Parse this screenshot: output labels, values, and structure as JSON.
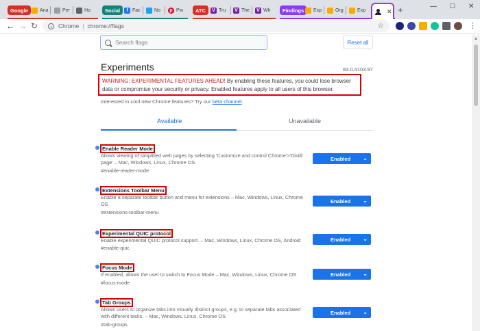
{
  "browser": {
    "tab_groups": [
      {
        "label": "Google",
        "color": "#d93025"
      },
      {
        "label": "Social",
        "color": "#12857a"
      },
      {
        "label": "ATC",
        "color": "#d93025"
      },
      {
        "label": "Findings",
        "color": "#8b3cf0"
      }
    ],
    "tabs": [
      {
        "label": "Ana",
        "icon": "analytics-icon",
        "color": "#f9ab00"
      },
      {
        "label": "Per",
        "icon": "bulb-icon",
        "color": "#5f6368"
      },
      {
        "label": "Ho",
        "icon": "hootsuite-icon",
        "color": "#5f6368"
      },
      {
        "label": "Fac",
        "icon": "facebook-icon",
        "color": "#1877f2"
      },
      {
        "label": "No",
        "icon": "twitter-icon",
        "color": "#1da1f2"
      },
      {
        "label": "Pin",
        "icon": "pinterest-icon",
        "color": "#e60023"
      },
      {
        "label": "Tru",
        "icon": "v-icon",
        "color": "#7b1fa2"
      },
      {
        "label": "The",
        "icon": "v-icon",
        "color": "#7b1fa2"
      },
      {
        "label": "Wh",
        "icon": "v-icon",
        "color": "#7b1fa2"
      },
      {
        "label": "Exp",
        "icon": "flask-icon",
        "color": "#f9ab00"
      },
      {
        "label": "Org",
        "icon": "flask-icon",
        "color": "#f9ab00"
      },
      {
        "label": "Exp",
        "icon": "flask-icon",
        "color": "#f9ab00"
      }
    ],
    "active_tab_icon": "incognito-icon",
    "omnibox": {
      "scheme": "Chrome",
      "divider": "|",
      "path": "chrome://flags"
    }
  },
  "flags_page": {
    "search_placeholder": "Search flags",
    "reset_label": "Reset all",
    "title": "Experiments",
    "version": "83.0.4103.97",
    "warning_strong": "WARNING: EXPERIMENTAL FEATURES AHEAD!",
    "warning_rest": " By enabling these features, you could lose browser data or compromise your security or privacy. Enabled features apply to all users of this browser.",
    "interest_text": "Interested in cool new Chrome features? Try our ",
    "interest_link": "beta channel",
    "interest_end": ".",
    "tab_available": "Available",
    "tab_unavailable": "Unavailable",
    "flags": [
      {
        "name": "Enable Reader Mode",
        "desc": "Allows viewing of simplified web pages by selecting 'Customize and control Chrome'>'Distill page' – Mac, Windows, Linux, Chrome OS",
        "hash": "#enable-reader-mode",
        "value": "Enabled"
      },
      {
        "name": "Extensions Toolbar Menu",
        "desc": "Enable a separate toolbar button and menu for extensions – Mac, Windows, Linux, Chrome OS",
        "hash": "#extensions-toolbar-menu",
        "value": "Enabled"
      },
      {
        "name": "Experimental QUIC protocol",
        "desc": "Enable experimental QUIC protocol support. – Mac, Windows, Linux, Chrome OS, Android",
        "hash": "#enable-quic",
        "value": "Enabled"
      },
      {
        "name": "Focus Mode",
        "desc": "If enabled, allows the user to switch to Focus Mode – Mac, Windows, Linux, Chrome OS",
        "hash": "#focus-mode",
        "value": "Enabled"
      },
      {
        "name": "Tab Groups",
        "desc": "Allows users to organize tabs into visually distinct groups, e.g. to separate tabs associated with different tasks. – Mac, Windows, Linux, Chrome OS",
        "hash": "#tab-groups",
        "value": "Enabled"
      }
    ]
  }
}
